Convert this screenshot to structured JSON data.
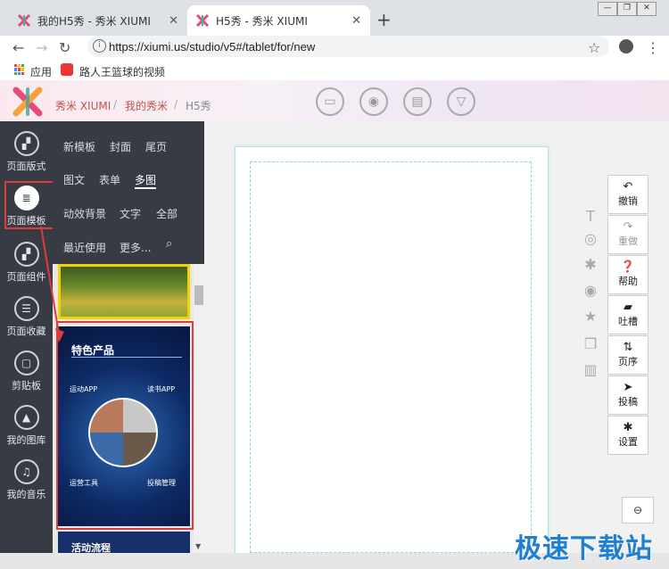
{
  "browser": {
    "tabs": [
      {
        "title": "我的H5秀 - 秀米 XIUMI",
        "active": false
      },
      {
        "title": "H5秀 - 秀米 XIUMI",
        "active": true
      }
    ],
    "new_tab": "+",
    "url": "https://xiumi.us/studio/v5#/tablet/for/new",
    "bookmarks": [
      {
        "label": "应用",
        "icon": "apps-grid-icon"
      },
      {
        "label": "路人王篮球的视频",
        "icon": "bookmark-video-icon"
      }
    ],
    "window_controls": [
      "minimize",
      "restore",
      "close"
    ]
  },
  "app": {
    "brand": "秀米 XIUMI",
    "breadcrumb": [
      "秀米 XIUMI",
      "我的秀米",
      "H5秀"
    ],
    "separators": "/",
    "header_icons": [
      "folder-icon",
      "preview-icon",
      "save-icon",
      "download-icon"
    ],
    "accent": "#c0504d"
  },
  "leftnav": {
    "items": [
      {
        "label": "页面版式",
        "icon": "layout-icon"
      },
      {
        "label": "页面模板",
        "icon": "template-icon",
        "active": true
      },
      {
        "label": "页面组件",
        "icon": "component-icon"
      },
      {
        "label": "页面收藏",
        "icon": "favorite-icon"
      },
      {
        "label": "剪贴板",
        "icon": "clipboard-icon"
      },
      {
        "label": "我的图库",
        "icon": "gallery-icon"
      },
      {
        "label": "我的音乐",
        "icon": "music-icon"
      }
    ]
  },
  "categories": {
    "rows": [
      [
        "新模板",
        "封面",
        "尾页"
      ],
      [
        "图文",
        "表单",
        "多图"
      ],
      [
        "动效背景",
        "文字",
        "全部"
      ],
      [
        "最近使用",
        "更多..."
      ]
    ],
    "active": "多图"
  },
  "template": {
    "title": "特色产品",
    "labels": [
      "运动APP",
      "读书APP",
      "运营工具",
      "投稿管理"
    ],
    "next_title": "活动流程"
  },
  "actions": [
    {
      "label": "撤销",
      "icon": "undo-icon",
      "enabled": true
    },
    {
      "label": "重做",
      "icon": "redo-icon",
      "enabled": false
    },
    {
      "label": "帮助",
      "icon": "help-icon",
      "enabled": true
    },
    {
      "label": "吐槽",
      "icon": "comment-icon",
      "enabled": true
    },
    {
      "label": "页序",
      "icon": "page-order-icon",
      "enabled": true
    },
    {
      "label": "投稿",
      "icon": "submit-icon",
      "enabled": true
    },
    {
      "label": "设置",
      "icon": "settings-icon",
      "enabled": true
    }
  ],
  "side_tools": [
    "text-icon",
    "play-icon",
    "sparkle-icon",
    "eye-off-icon",
    "star-icon",
    "copy-icon",
    "trash-icon"
  ],
  "watermark": "极速下载站"
}
